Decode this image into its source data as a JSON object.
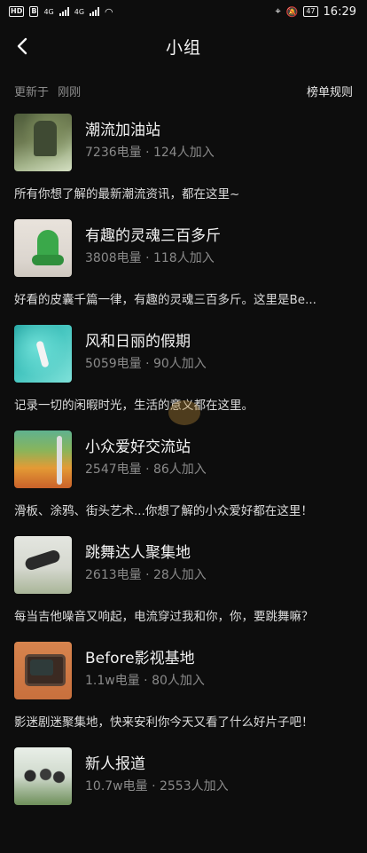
{
  "status_bar": {
    "left_chips": [
      "HD",
      "B"
    ],
    "network_labels": [
      "4G",
      "4G"
    ],
    "battery": "47",
    "time": "16:29"
  },
  "header": {
    "title": "小组",
    "back_icon": "chevron-left-icon"
  },
  "subheader": {
    "update_label": "更新于",
    "update_value": "刚刚",
    "rules_label": "榜单规则"
  },
  "groups": [
    {
      "name": "潮流加油站",
      "stats": "7236电量 · 124人加入",
      "desc": "所有你想了解的最新潮流资讯，都在这里~"
    },
    {
      "name": "有趣的灵魂三百多斤",
      "stats": "3808电量 · 118人加入",
      "desc": "好看的皮囊千篇一律，有趣的灵魂三百多斤。这里是Be..."
    },
    {
      "name": "风和日丽的假期",
      "stats": "5059电量 · 90人加入",
      "desc": "记录一切的闲暇时光，生活的意义都在这里。"
    },
    {
      "name": "小众爱好交流站",
      "stats": "2547电量 · 86人加入",
      "desc": "滑板、涂鸦、街头艺术...你想了解的小众爱好都在这里！"
    },
    {
      "name": "跳舞达人聚集地",
      "stats": "2613电量 · 28人加入",
      "desc": "每当吉他噪音又响起，电流穿过我和你，你，要跳舞嘛？"
    },
    {
      "name": "Before影视基地",
      "stats": "1.1w电量 · 80人加入",
      "desc": "影迷剧迷聚集地，快来安利你今天又看了什么好片子吧！"
    },
    {
      "name": "新人报道",
      "stats": "10.7w电量 · 2553人加入",
      "desc": ""
    }
  ]
}
